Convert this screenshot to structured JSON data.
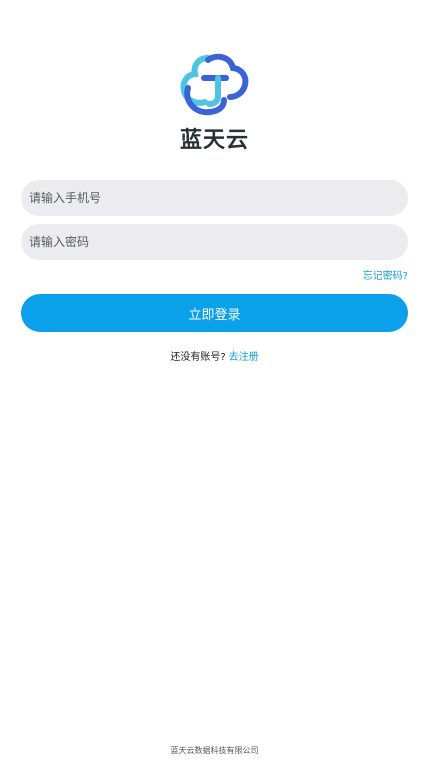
{
  "brand": {
    "logo_icon": "cloud-t-logo-icon",
    "name": "蓝天云",
    "colors": {
      "logo_light": "#4fc3e3",
      "logo_dark": "#3a63d8",
      "accent": "#0aa1ea",
      "link": "#109ee0"
    }
  },
  "login_form": {
    "phone_placeholder": "请输入手机号",
    "password_placeholder": "请输入密码",
    "forgot_password": "忘记密码?",
    "submit_label": "立即登录"
  },
  "register": {
    "prompt": "还没有账号?",
    "link_label": "去注册"
  },
  "footer": {
    "company": "蓝天云数据科技有限公司"
  }
}
